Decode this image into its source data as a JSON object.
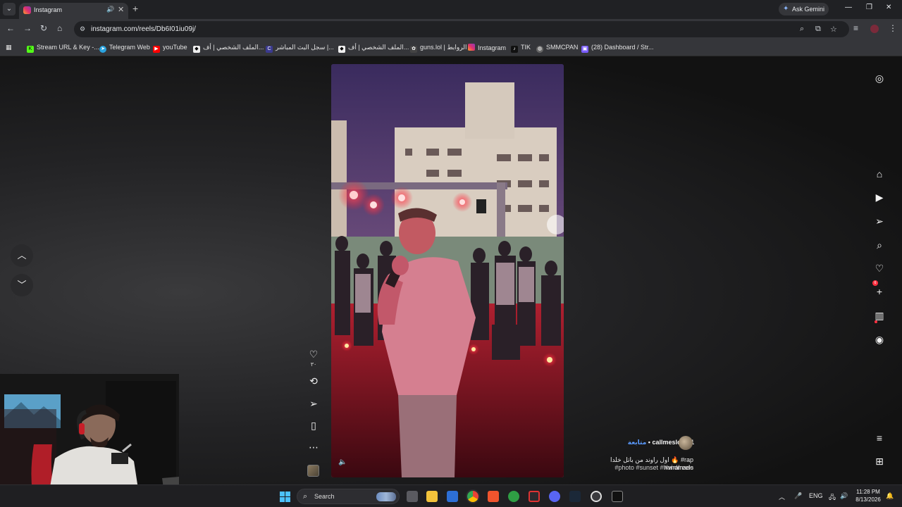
{
  "browser": {
    "tab_title": "Instagram",
    "url": "instagram.com/reels/Db6I01iu09j/",
    "ask_gemini": "Ask Gemini",
    "bookmarks": [
      "Stream URL & Key -...",
      "Telegram Web",
      "youTube",
      "الملف الشخصي | أف...",
      "سجل البث المباشر |...",
      "الملف الشخصي | أف...",
      "guns.lol | الروابط",
      "Instagram",
      "TIK",
      "SMMCPAN",
      "(28) Dashboard / Str..."
    ]
  },
  "reel": {
    "like_count": "٣٠",
    "author": "callmesloom1",
    "follow_label": "متابعة",
    "separator": "•",
    "caption_line1": "اول راوند من باتل خلدا 🔥 #rap #viralreels",
    "caption_line2": "#photo #sunset #handmade"
  },
  "sidebar": {
    "notification_count": "6"
  },
  "taskbar": {
    "search_label": "Search",
    "language": "ENG",
    "time": "11:28 PM",
    "date": "8/13/2026"
  },
  "colors": {
    "instagram_accent": "#ff3040",
    "follow_link": "#5b9bff",
    "windows_blue": "#4cc2ff"
  }
}
